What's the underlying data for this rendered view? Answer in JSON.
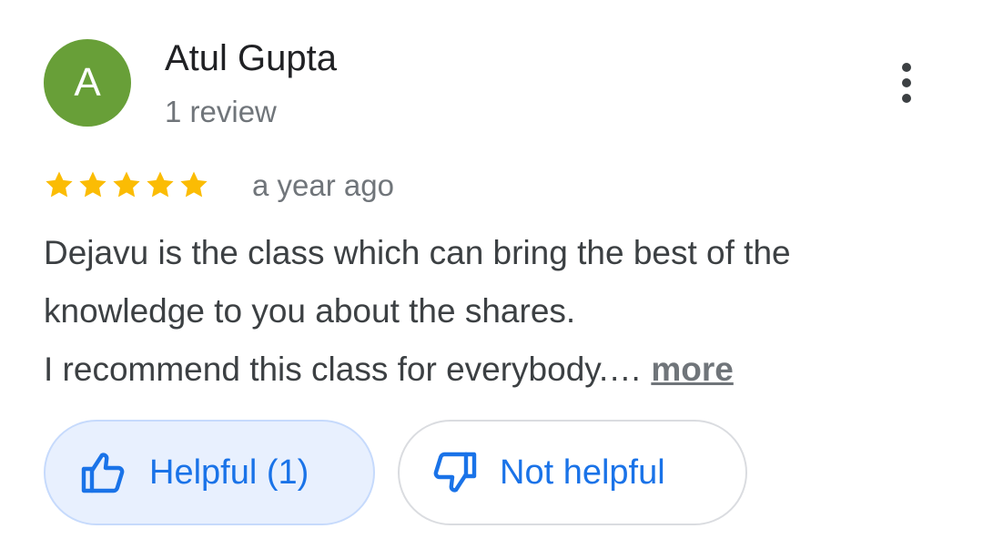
{
  "review": {
    "avatar_letter": "A",
    "author": "Atul Gupta",
    "author_meta": "1 review",
    "rating": 5,
    "rating_max": 5,
    "time_ago": "a year ago",
    "text_lines": [
      "Dejavu is the class which can bring the best of the",
      "knowledge to you about the shares.",
      "I recommend this class for everybody.…"
    ],
    "more_label": "more"
  },
  "actions": {
    "helpful_label": "Helpful (1)",
    "not_helpful_label": "Not helpful"
  },
  "colors": {
    "avatar": "#689f38",
    "star": "#fbbc04",
    "accent": "#1a73e8"
  },
  "icons": {
    "menu": "more-vert-icon",
    "helpful": "thumb-up-icon",
    "not_helpful": "thumb-down-icon",
    "rating": "star-icon"
  }
}
